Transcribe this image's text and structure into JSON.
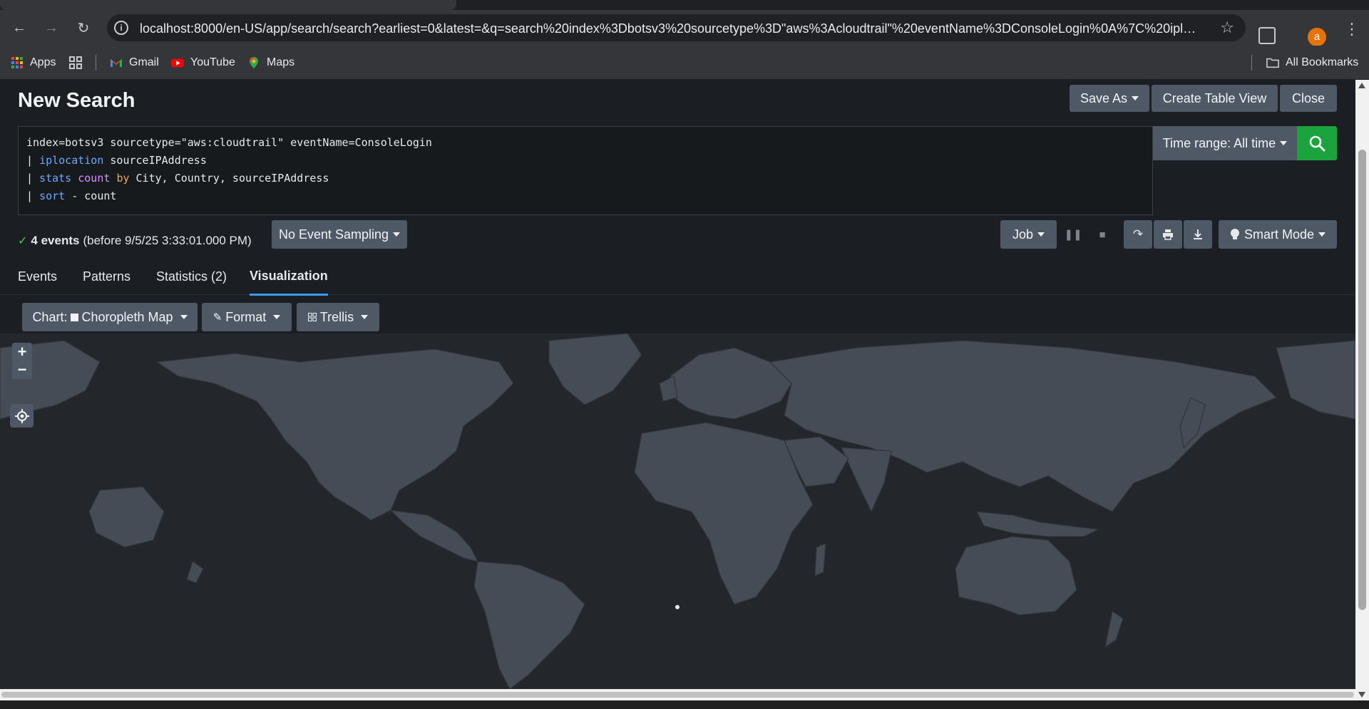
{
  "browser": {
    "url": "localhost:8000/en-US/app/search/search?earliest=0&latest=&q=search%20index%3Dbotsv3%20sourcetype%3D\"aws%3Acloudtrail\"%20eventName%3DConsoleLogin%0A%7C%20iplocation%...",
    "profile_initial": "a",
    "bookmarks": {
      "apps": "Apps",
      "gmail": "Gmail",
      "youtube": "YouTube",
      "maps": "Maps",
      "all_bookmarks": "All Bookmarks"
    }
  },
  "page": {
    "title": "New Search",
    "save_as": "Save As",
    "create_table_view": "Create Table View",
    "close": "Close"
  },
  "search": {
    "line1": {
      "text": "index=botsv3 sourcetype=\"aws:cloudtrail\" eventName=ConsoleLogin"
    },
    "line2": {
      "pipe": "| ",
      "cmd": "iplocation",
      "rest": " sourceIPAddress"
    },
    "line3": {
      "pipe": "| ",
      "cmd": "stats",
      "fn": "count",
      "by": "by",
      "rest": " City, Country, sourceIPAddress"
    },
    "line4": {
      "pipe": "| ",
      "cmd": "sort",
      "rest": " - count"
    },
    "time_range": "Time range: All time"
  },
  "status": {
    "events": "4 events",
    "before": "(before 9/5/25 3:33:01.000 PM)",
    "sampling": "No Event Sampling",
    "job": "Job",
    "mode": "Smart Mode"
  },
  "tabs": {
    "events": "Events",
    "patterns": "Patterns",
    "statistics": "Statistics (2)",
    "visualization": "Visualization"
  },
  "viz": {
    "chart_label": "Chart:",
    "chart_type": "Choropleth Map",
    "format": "Format",
    "trellis": "Trellis"
  },
  "colors": {
    "accent": "#3c9bf0",
    "search_green": "#1ba33e",
    "button_gray": "#4f5966",
    "map_land": "#464c55",
    "map_bg": "#23262a"
  }
}
